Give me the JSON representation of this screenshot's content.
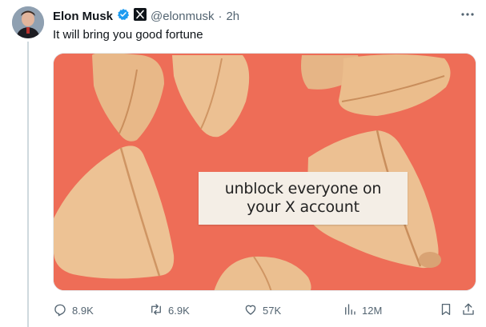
{
  "author": {
    "name": "Elon Musk",
    "handle": "@elonmusk",
    "separator": "·",
    "time": "2h",
    "verified_icon": "verified-badge-icon",
    "affiliation_icon": "x-logo-icon"
  },
  "tweet": {
    "text": "It will bring you good fortune"
  },
  "media": {
    "fortune_line1": "unblock everyone on",
    "fortune_line2": "your X account",
    "background_color": "#ee6d57"
  },
  "actions": {
    "replies": "8.9K",
    "reposts": "6.9K",
    "likes": "57K",
    "views": "12M"
  },
  "colors": {
    "text": "#0f1419",
    "secondary": "#536471",
    "verified": "#1d9bf0"
  }
}
